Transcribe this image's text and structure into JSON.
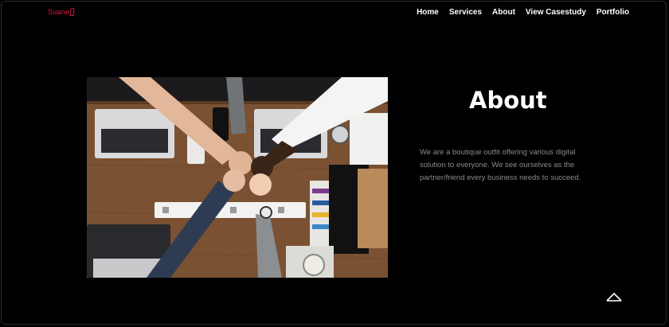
{
  "brand": {
    "logo_text": "Suane"
  },
  "nav": {
    "items": [
      {
        "label": "Home",
        "name": "nav-home"
      },
      {
        "label": "Services",
        "name": "nav-services"
      },
      {
        "label": "About",
        "name": "nav-about"
      },
      {
        "label": "View Casestudy",
        "name": "nav-view-casestudy"
      },
      {
        "label": "Portfolio",
        "name": "nav-portfolio"
      }
    ]
  },
  "about": {
    "title": "About",
    "description": "We are a boutique outfit offering various digital solution to everyone. We see ourselves as the partner/friend every business needs to succeed.",
    "image_alt": "team-hands-together-photo"
  },
  "scroll_top": {
    "icon": "chevron-up-icon"
  },
  "colors": {
    "background": "#000000",
    "brand": "#e0193f",
    "text": "#ffffff",
    "muted_text": "#8a8a8a"
  }
}
